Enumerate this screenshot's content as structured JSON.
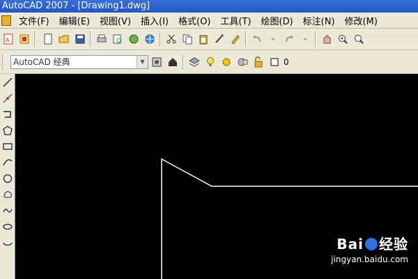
{
  "window": {
    "title": "AutoCAD 2007 - [Drawing1.dwg]"
  },
  "menu": {
    "items": [
      {
        "label": "文件(F)"
      },
      {
        "label": "编辑(E)"
      },
      {
        "label": "视图(V)"
      },
      {
        "label": "插入(I)"
      },
      {
        "label": "格式(O)"
      },
      {
        "label": "工具(T)"
      },
      {
        "label": "绘图(D)"
      },
      {
        "label": "标注(N)"
      },
      {
        "label": "修改(M)"
      }
    ]
  },
  "workspace": {
    "selected": "AutoCAD 经典"
  },
  "layer": {
    "current": "0"
  },
  "watermark": {
    "brand_prefix": "Bai",
    "brand_suffix": "经验",
    "site": "jingyan.baidu.com"
  },
  "colors": {
    "canvas": "#000000",
    "drawing_line": "#ffffff",
    "toolbar": "#ece9d8",
    "titlebar": "#2256c7"
  }
}
